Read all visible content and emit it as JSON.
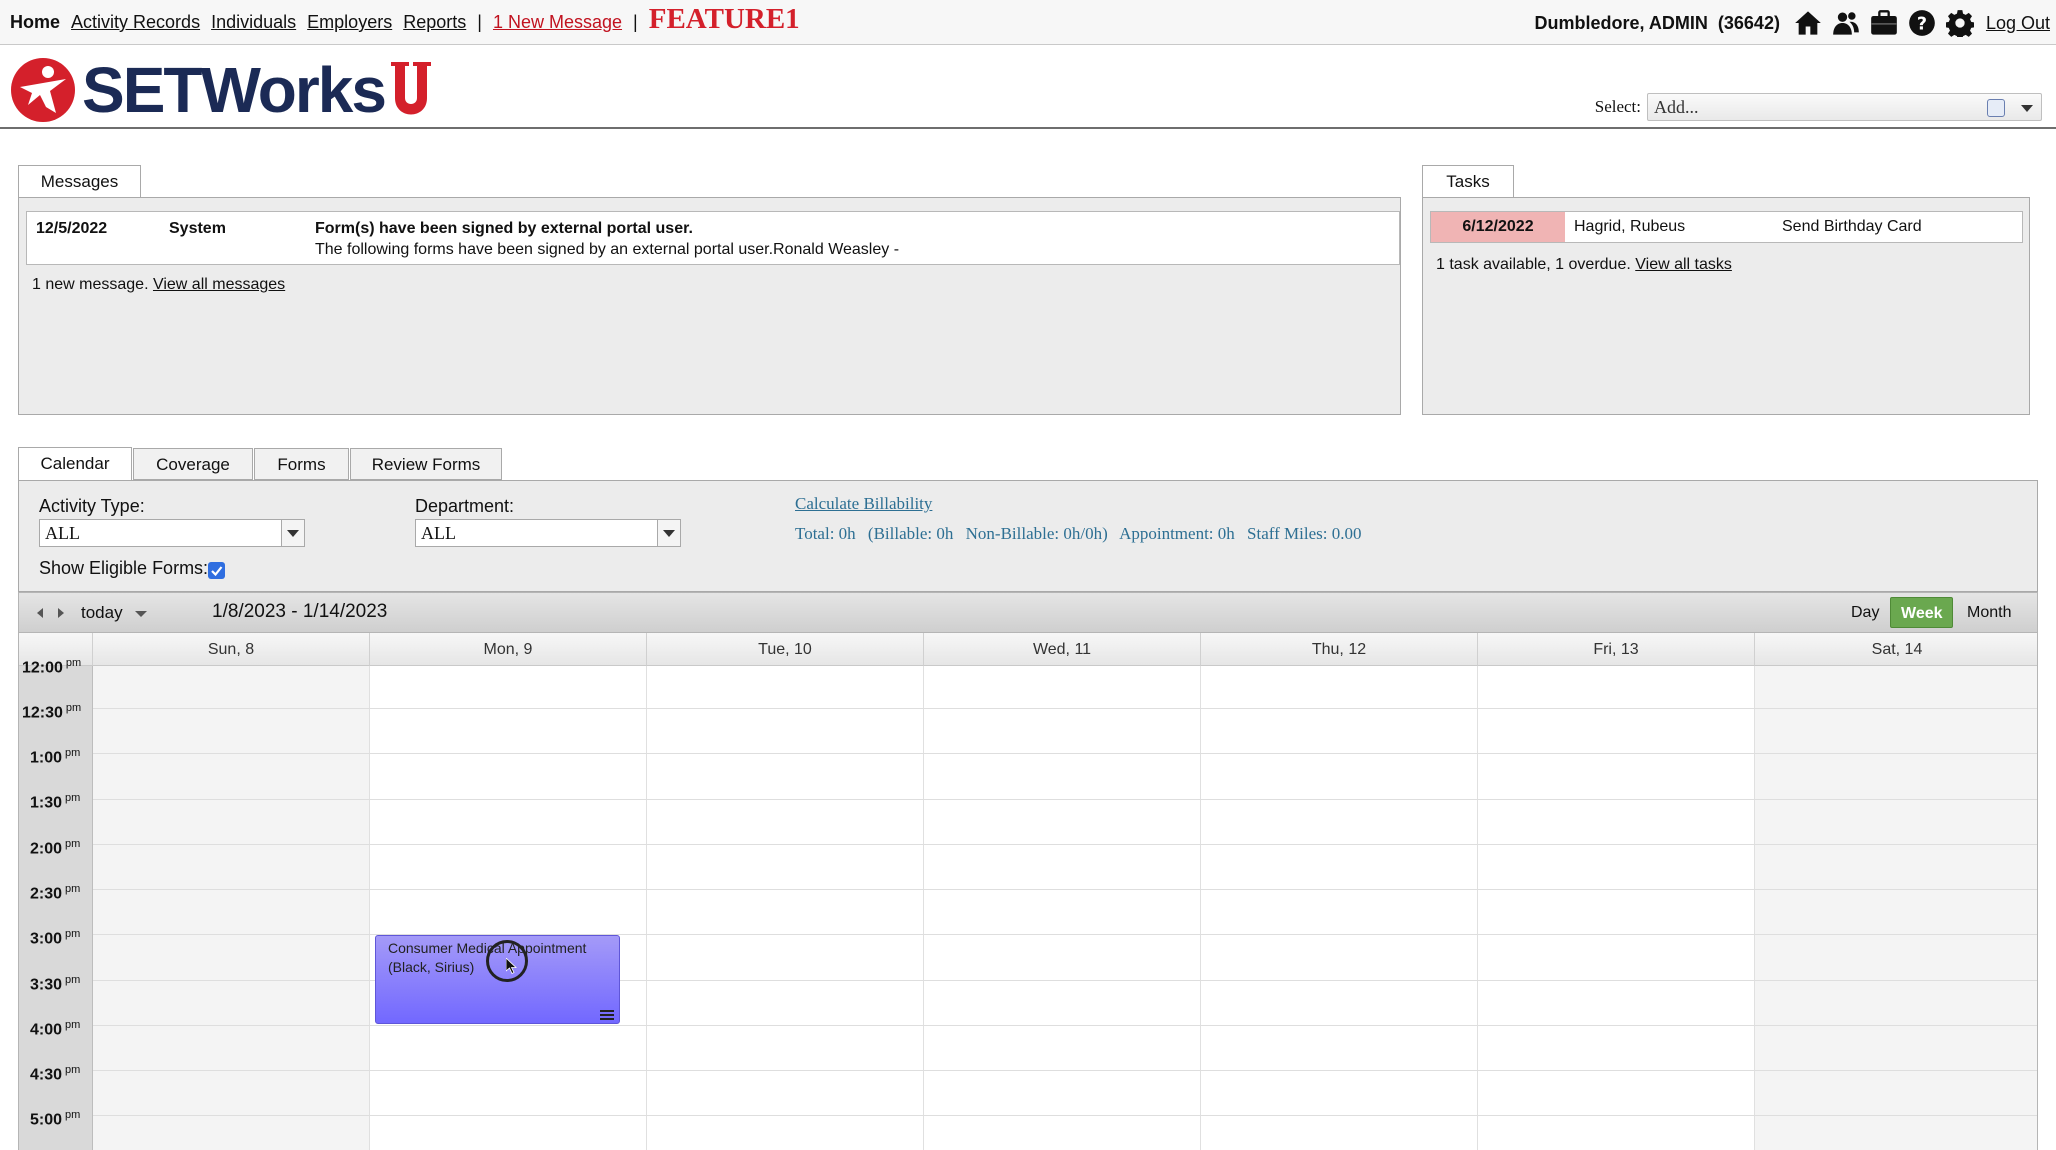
{
  "topnav": {
    "home": "Home",
    "links": [
      "Activity Records",
      "Individuals",
      "Employers",
      "Reports"
    ],
    "separator": "|",
    "new_message": "1 New Message",
    "feature_tag": "FEATURE1",
    "user": "Dumbledore, ADMIN",
    "user_id": "(36642)",
    "icons": [
      "home-icon",
      "people-icon",
      "briefcase-icon",
      "help-icon",
      "gear-icon"
    ],
    "logout": "Log Out"
  },
  "header": {
    "logo_text": "SETWorks",
    "select_label": "Select:",
    "select_placeholder": "Add..."
  },
  "messages": {
    "tab_label": "Messages",
    "items": [
      {
        "date": "12/5/2022",
        "sender": "System",
        "subject": "Form(s) have been signed by external portal user.",
        "body": "The following forms have been signed by an external portal user.Ronald Weasley -"
      }
    ],
    "summary": "1 new message.",
    "view_all": "View all messages"
  },
  "tasks": {
    "tab_label": "Tasks",
    "items": [
      {
        "date": "6/12/2022",
        "name": "Hagrid, Rubeus",
        "title": "Send Birthday Card",
        "overdue": true
      }
    ],
    "summary": "1 task available, 1 overdue.",
    "view_all": "View all tasks"
  },
  "calendar_tabs": [
    "Calendar",
    "Coverage",
    "Forms",
    "Review Forms"
  ],
  "filters": {
    "activity_type_label": "Activity Type:",
    "activity_type_value": "ALL",
    "department_label": "Department:",
    "department_value": "ALL",
    "eligible_forms_label": "Show Eligible Forms:",
    "eligible_forms_checked": true,
    "calculate_link": "Calculate Billability",
    "totals": {
      "total": "Total: 0h",
      "billable": "(Billable: 0h",
      "non_billable": "Non-Billable: 0h/0h)",
      "appointment": "Appointment: 0h",
      "staff_miles": "Staff Miles: 0.00"
    }
  },
  "calendar": {
    "today_label": "today",
    "range": "1/8/2023 - 1/14/2023",
    "views": [
      "Day",
      "Week",
      "Month"
    ],
    "active_view": "Week",
    "days": [
      "Sun, 8",
      "Mon, 9",
      "Tue, 10",
      "Wed, 11",
      "Thu, 12",
      "Fri, 13",
      "Sat, 14"
    ],
    "times": [
      "12:00",
      "12:30",
      "1:00",
      "1:30",
      "2:00",
      "2:30",
      "3:00",
      "3:30",
      "4:00",
      "4:30",
      "5:00"
    ],
    "meridiem": "pm",
    "event": {
      "title": "Consumer Medical Appointment",
      "subtitle": "(Black, Sirius)",
      "day": "Mon, 9",
      "start": "3:00 pm",
      "end": "4:00 pm",
      "color": "#7b72ff"
    }
  },
  "colors": {
    "accent_red": "#d4202b",
    "overdue": "#f0b4b4",
    "active_view": "#6aa84f",
    "link_blue": "#2d6f93"
  }
}
